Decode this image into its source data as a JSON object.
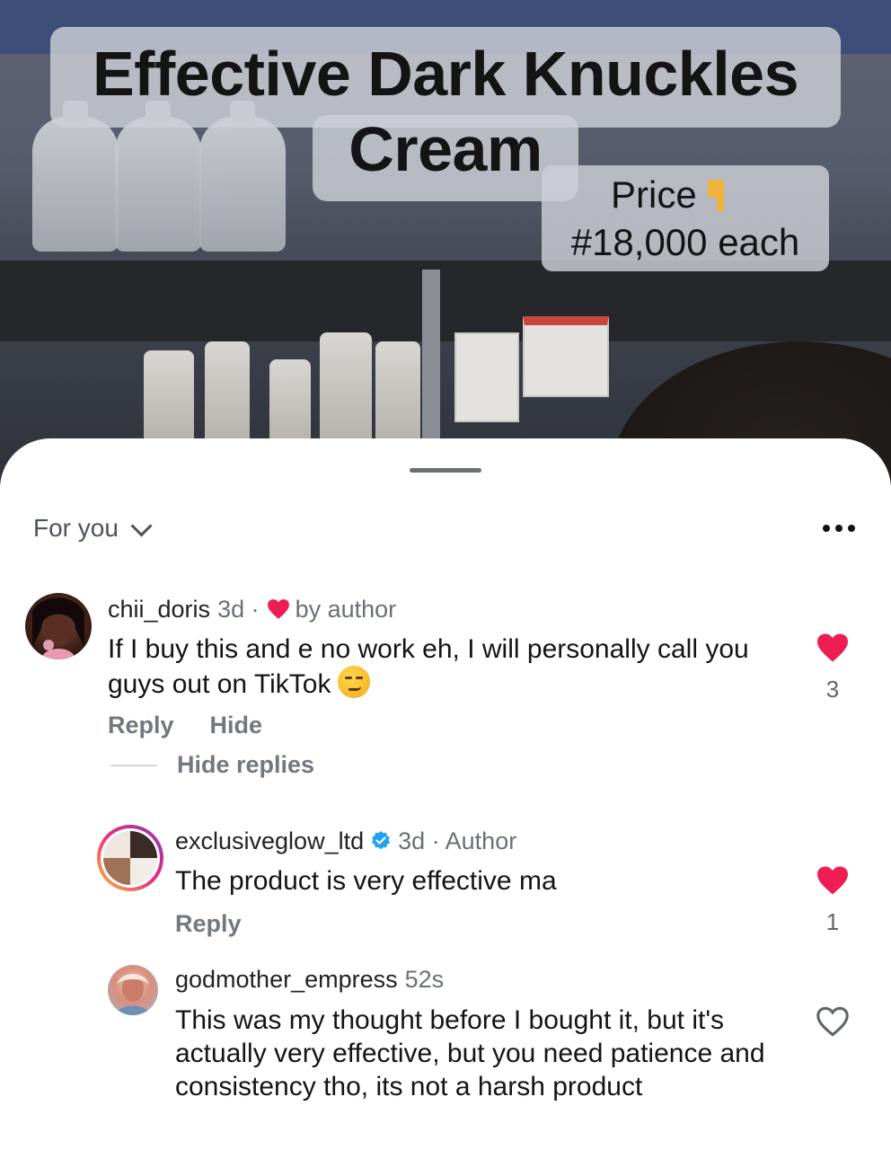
{
  "video": {
    "title": "Effective Dark Knuckles Cream",
    "price_label": "Price",
    "price_value": "#18,000 each"
  },
  "comments_header": {
    "sort_label": "For you"
  },
  "comments": [
    {
      "username": "chii_doris",
      "time": "3d ·",
      "liked_by_author": "by author",
      "text": "If I buy this and e no work eh, I will personally call you guys out on TikTok",
      "emoji": "smirking-face",
      "like_count": "3",
      "liked": true,
      "reply_label": "Reply",
      "hide_label": "Hide",
      "hide_replies_label": "Hide replies"
    },
    {
      "username": "exclusiveglow_ltd",
      "time": "3d · Author",
      "verified": true,
      "text": "The product is very effective ma",
      "like_count": "1",
      "liked": true,
      "reply_label": "Reply"
    },
    {
      "username": "godmother_empress",
      "time": "52s",
      "text": "This was my thought before I bought it, but it's actually very effective,  but you need patience and consistency tho, its not a harsh product",
      "liked": false
    }
  ],
  "colors": {
    "like_red": "#ee1d52",
    "verified_blue": "#20a1f1",
    "muted_text": "#737880"
  }
}
